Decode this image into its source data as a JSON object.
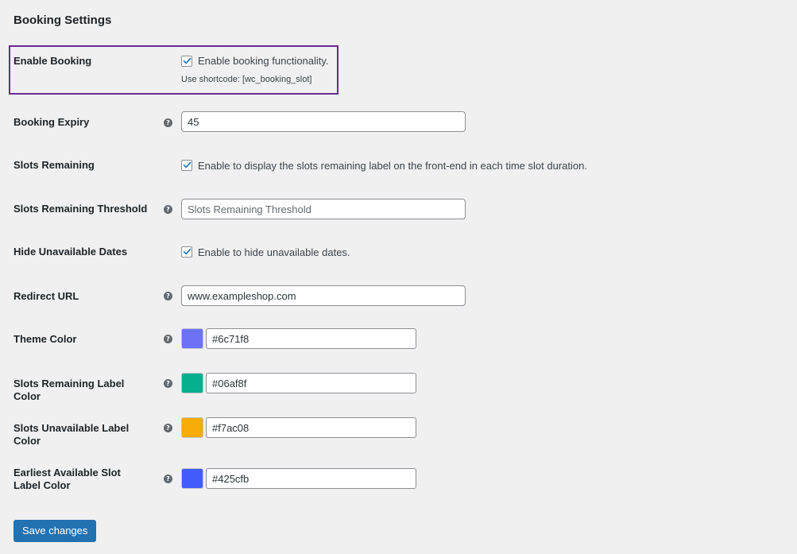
{
  "page": {
    "title": "Booking Settings",
    "highlight_color": "#6b2c91",
    "help_icon_glyph": "?"
  },
  "enable_booking": {
    "label": "Enable Booking",
    "checked": true,
    "checkbox_label": "Enable booking functionality.",
    "description": "Use shortcode: [wc_booking_slot]"
  },
  "booking_expiry": {
    "label": "Booking Expiry",
    "value": "45"
  },
  "slots_remaining": {
    "label": "Slots Remaining",
    "checked": true,
    "checkbox_label": "Enable to display the slots remaining label on the front-end in each time slot duration."
  },
  "slots_remaining_threshold": {
    "label": "Slots Remaining Threshold",
    "value": "",
    "placeholder": "Slots Remaining Threshold"
  },
  "hide_unavailable_dates": {
    "label": "Hide Unavailable Dates",
    "checked": true,
    "checkbox_label": "Enable to hide unavailable dates."
  },
  "redirect_url": {
    "label": "Redirect URL",
    "value": "www.exampleshop.com"
  },
  "theme_color": {
    "label": "Theme Color",
    "value": "#6c71f8"
  },
  "slots_remaining_label_color": {
    "label": "Slots Remaining Label Color",
    "value": "#06af8f"
  },
  "slots_unavailable_label_color": {
    "label": "Slots Unavailable Label Color",
    "value": "#f7ac08"
  },
  "earliest_available_slot_label_color": {
    "label": "Earliest Available Slot Label Color",
    "value": "#425cfb"
  },
  "footer": {
    "save_label": "Save changes"
  },
  "icons": {
    "help": "question-circle-icon",
    "check": "checkmark-icon"
  },
  "colors": {
    "primary_button": "#2271b1",
    "checkbox_check": "#2271b1"
  }
}
